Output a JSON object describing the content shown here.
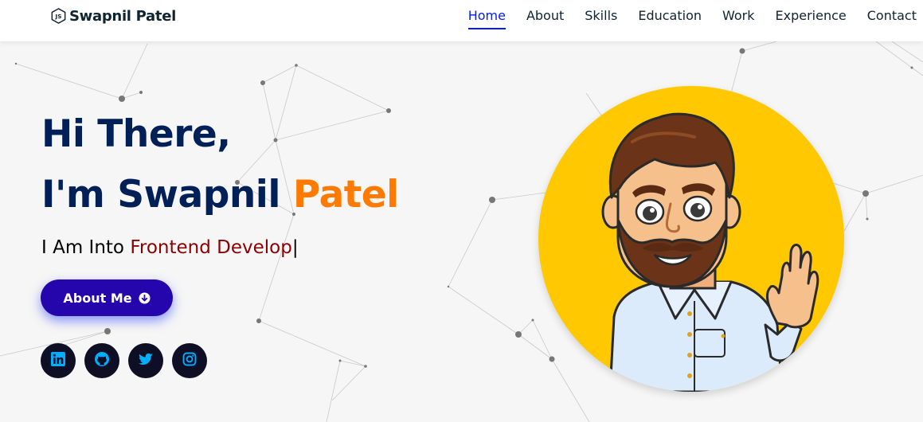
{
  "header": {
    "logo_text": "Swapnil Patel",
    "logo_icon": "js-hexagon-icon",
    "nav": [
      {
        "label": "Home",
        "active": true
      },
      {
        "label": "About",
        "active": false
      },
      {
        "label": "Skills",
        "active": false
      },
      {
        "label": "Education",
        "active": false
      },
      {
        "label": "Work",
        "active": false
      },
      {
        "label": "Experience",
        "active": false
      },
      {
        "label": "Contact",
        "active": false
      }
    ]
  },
  "hero": {
    "greeting": "Hi There,",
    "intro_prefix": "I'm Swapnil",
    "intro_name": "Patel",
    "typing_prefix": "I Am Into",
    "typing_value": "Frontend Develop",
    "typing_cursor": "|",
    "button_label": "About Me",
    "button_icon": "arrow-circle-down-icon"
  },
  "socials": [
    {
      "name": "linkedin-icon"
    },
    {
      "name": "github-icon"
    },
    {
      "name": "twitter-icon"
    },
    {
      "name": "instagram-icon"
    }
  ],
  "colors": {
    "nav_active": "#011aff",
    "heading": "#002057",
    "accent": "#ff7a00",
    "typed": "#8b0000",
    "button": "#2506ad",
    "avatar_bg": "#ffc800",
    "social_bg": "#0e0e25",
    "social_icon": "#00aeff"
  }
}
